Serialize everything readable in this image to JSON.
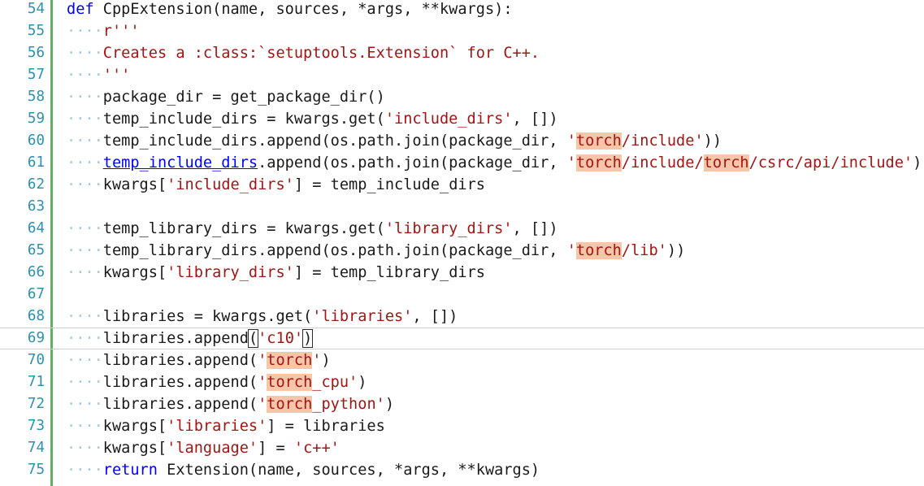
{
  "editor": {
    "lines": [
      {
        "n": "54",
        "tokens": [
          {
            "t": "def",
            "c": "kw"
          },
          {
            "t": " CppExtension(name, sources, *args, **kwargs):",
            "c": "pl"
          }
        ]
      },
      {
        "n": "55",
        "tokens": [
          {
            "t": "····",
            "c": "ws"
          },
          {
            "t": "r'''",
            "c": "str"
          }
        ]
      },
      {
        "n": "56",
        "tokens": [
          {
            "t": "····",
            "c": "ws"
          },
          {
            "t": "Creates a :class:`setuptools.Extension` for C++.",
            "c": "str"
          }
        ]
      },
      {
        "n": "57",
        "tokens": [
          {
            "t": "····",
            "c": "ws"
          },
          {
            "t": "'''",
            "c": "str"
          }
        ]
      },
      {
        "n": "58",
        "tokens": [
          {
            "t": "····",
            "c": "ws"
          },
          {
            "t": "package_dir = get_package_dir()",
            "c": "pl"
          }
        ]
      },
      {
        "n": "59",
        "tokens": [
          {
            "t": "····",
            "c": "ws"
          },
          {
            "t": "temp_include_dirs = kwargs.get(",
            "c": "pl"
          },
          {
            "t": "'include_dirs'",
            "c": "str"
          },
          {
            "t": ", [])",
            "c": "pl"
          }
        ]
      },
      {
        "n": "60",
        "tokens": [
          {
            "t": "····",
            "c": "ws"
          },
          {
            "t": "temp_include_dirs.append(os.path.join(package_dir, ",
            "c": "pl"
          },
          {
            "t": "'",
            "c": "str"
          },
          {
            "t": "torch",
            "c": "str hl"
          },
          {
            "t": "/include'",
            "c": "str"
          },
          {
            "t": "))",
            "c": "pl"
          }
        ]
      },
      {
        "n": "61",
        "tokens": [
          {
            "t": "····",
            "c": "ws"
          },
          {
            "t": "temp_include_dirs",
            "c": "ul"
          },
          {
            "t": ".append(os.path.join(package_dir, ",
            "c": "pl"
          },
          {
            "t": "'",
            "c": "str"
          },
          {
            "t": "torch",
            "c": "str hl"
          },
          {
            "t": "/include/",
            "c": "str"
          },
          {
            "t": "torch",
            "c": "str hl"
          },
          {
            "t": "/csrc/api/include'",
            "c": "str"
          },
          {
            "t": "))",
            "c": "pl"
          }
        ]
      },
      {
        "n": "62",
        "tokens": [
          {
            "t": "····",
            "c": "ws"
          },
          {
            "t": "kwargs[",
            "c": "pl"
          },
          {
            "t": "'include_dirs'",
            "c": "str"
          },
          {
            "t": "] = temp_include_dirs",
            "c": "pl"
          }
        ]
      },
      {
        "n": "63",
        "tokens": []
      },
      {
        "n": "64",
        "tokens": [
          {
            "t": "····",
            "c": "ws"
          },
          {
            "t": "temp_library_dirs = kwargs.get(",
            "c": "pl"
          },
          {
            "t": "'library_dirs'",
            "c": "str"
          },
          {
            "t": ", [])",
            "c": "pl"
          }
        ]
      },
      {
        "n": "65",
        "tokens": [
          {
            "t": "····",
            "c": "ws"
          },
          {
            "t": "temp_library_dirs.append(os.path.join(package_dir, ",
            "c": "pl"
          },
          {
            "t": "'",
            "c": "str"
          },
          {
            "t": "torch",
            "c": "str hl"
          },
          {
            "t": "/lib'",
            "c": "str"
          },
          {
            "t": "))",
            "c": "pl"
          }
        ]
      },
      {
        "n": "66",
        "tokens": [
          {
            "t": "····",
            "c": "ws"
          },
          {
            "t": "kwargs[",
            "c": "pl"
          },
          {
            "t": "'library_dirs'",
            "c": "str"
          },
          {
            "t": "] = temp_library_dirs",
            "c": "pl"
          }
        ]
      },
      {
        "n": "67",
        "tokens": []
      },
      {
        "n": "68",
        "tokens": [
          {
            "t": "····",
            "c": "ws"
          },
          {
            "t": "libraries = kwargs.get(",
            "c": "pl"
          },
          {
            "t": "'libraries'",
            "c": "str"
          },
          {
            "t": ", [])",
            "c": "pl"
          }
        ]
      },
      {
        "n": "69",
        "current": true,
        "tokens": [
          {
            "t": "····",
            "c": "ws"
          },
          {
            "t": "libraries.append",
            "c": "pl"
          },
          {
            "t": "(",
            "c": "pl bm"
          },
          {
            "t": "'c10'",
            "c": "str"
          },
          {
            "t": ")",
            "c": "pl bm"
          }
        ]
      },
      {
        "n": "70",
        "tokens": [
          {
            "t": "····",
            "c": "ws"
          },
          {
            "t": "libraries.append(",
            "c": "pl"
          },
          {
            "t": "'",
            "c": "str"
          },
          {
            "t": "torch",
            "c": "str hl"
          },
          {
            "t": "'",
            "c": "str"
          },
          {
            "t": ")",
            "c": "pl"
          }
        ]
      },
      {
        "n": "71",
        "tokens": [
          {
            "t": "····",
            "c": "ws"
          },
          {
            "t": "libraries.append(",
            "c": "pl"
          },
          {
            "t": "'",
            "c": "str"
          },
          {
            "t": "torch",
            "c": "str hl"
          },
          {
            "t": "_cpu'",
            "c": "str"
          },
          {
            "t": ")",
            "c": "pl"
          }
        ]
      },
      {
        "n": "72",
        "tokens": [
          {
            "t": "····",
            "c": "ws"
          },
          {
            "t": "libraries.append(",
            "c": "pl"
          },
          {
            "t": "'",
            "c": "str"
          },
          {
            "t": "torch",
            "c": "str hl"
          },
          {
            "t": "_python'",
            "c": "str"
          },
          {
            "t": ")",
            "c": "pl"
          }
        ]
      },
      {
        "n": "73",
        "tokens": [
          {
            "t": "····",
            "c": "ws"
          },
          {
            "t": "kwargs[",
            "c": "pl"
          },
          {
            "t": "'libraries'",
            "c": "str"
          },
          {
            "t": "] = libraries",
            "c": "pl"
          }
        ]
      },
      {
        "n": "74",
        "tokens": [
          {
            "t": "····",
            "c": "ws"
          },
          {
            "t": "kwargs[",
            "c": "pl"
          },
          {
            "t": "'language'",
            "c": "str"
          },
          {
            "t": "] = ",
            "c": "pl"
          },
          {
            "t": "'c++'",
            "c": "str"
          }
        ]
      },
      {
        "n": "75",
        "tokens": [
          {
            "t": "····",
            "c": "ws"
          },
          {
            "t": "return",
            "c": "kw"
          },
          {
            "t": " Extension(name, sources, *args, **kwargs)",
            "c": "pl"
          }
        ]
      }
    ]
  },
  "colors": {
    "line_number": "#2b91af",
    "keyword": "#0000ff",
    "string": "#a31515",
    "highlight": "#f7c6a8",
    "change_bar": "#5bb35b"
  }
}
